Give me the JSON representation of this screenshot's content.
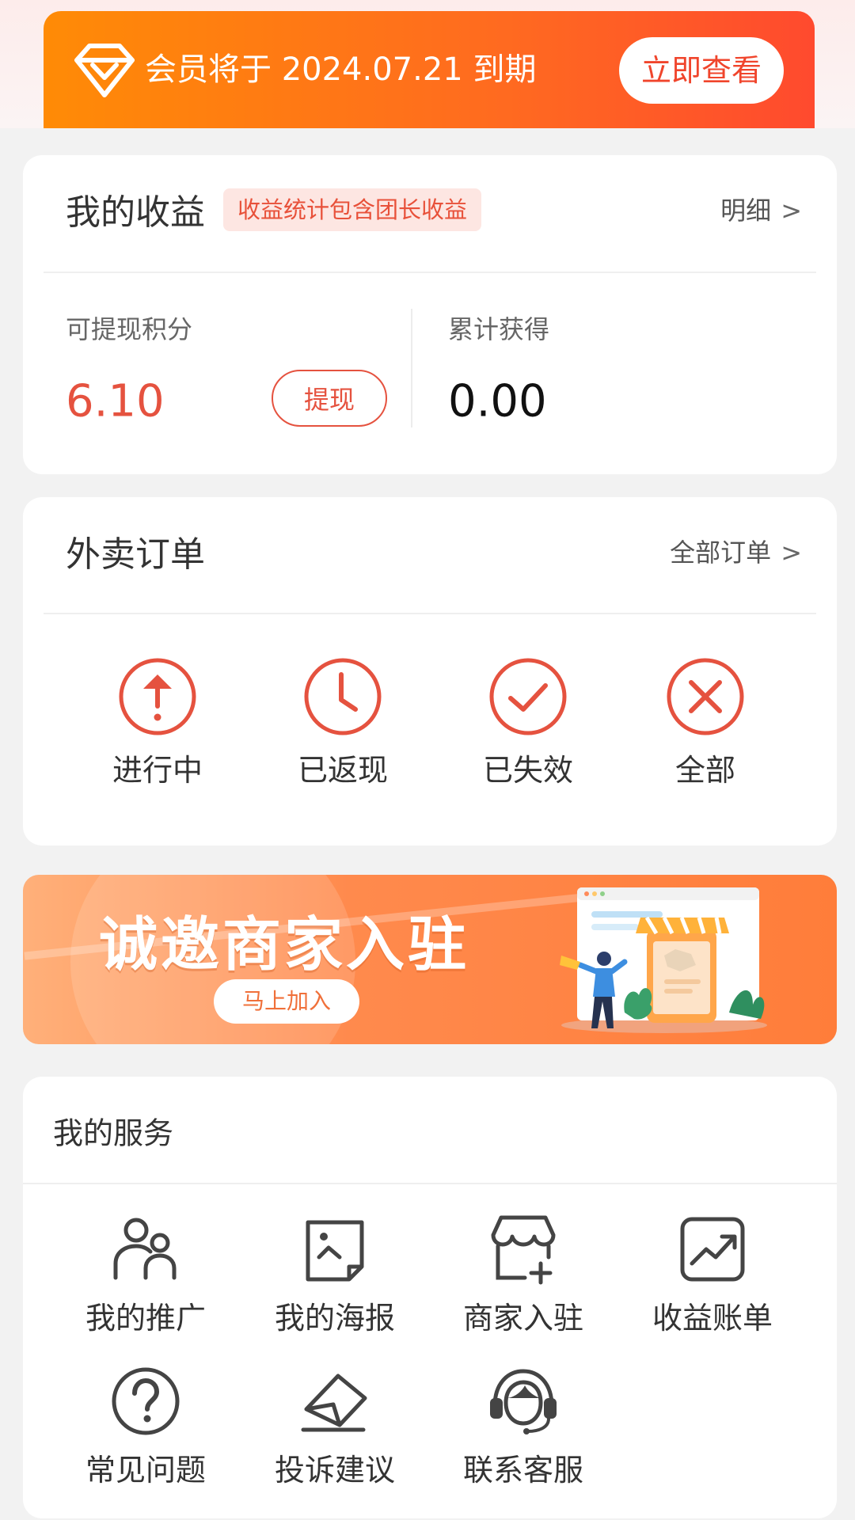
{
  "vip": {
    "text": "会员将于 2024.07.21 到期",
    "button": "立即查看"
  },
  "earnings": {
    "title": "我的收益",
    "tag": "收益统计包含团长收益",
    "detail_link": "明细",
    "withdrawable_label": "可提现积分",
    "withdrawable_value": "6.10",
    "withdraw_button": "提现",
    "total_label": "累计获得",
    "total_value": "0.00"
  },
  "orders": {
    "title": "外卖订单",
    "all_link": "全部订单",
    "items": [
      {
        "label": "进行中",
        "icon": "arrow-up-circle-icon"
      },
      {
        "label": "已返现",
        "icon": "clock-icon"
      },
      {
        "label": "已失效",
        "icon": "check-circle-icon"
      },
      {
        "label": "全部",
        "icon": "x-circle-icon"
      }
    ]
  },
  "promo": {
    "title": "诚邀商家入驻",
    "button": "马上加入"
  },
  "services": {
    "title": "我的服务",
    "items": [
      {
        "label": "我的推广",
        "icon": "users-icon"
      },
      {
        "label": "我的海报",
        "icon": "image-icon"
      },
      {
        "label": "商家入驻",
        "icon": "store-add-icon"
      },
      {
        "label": "收益账单",
        "icon": "trend-chart-icon"
      },
      {
        "label": "常见问题",
        "icon": "question-icon"
      },
      {
        "label": "投诉建议",
        "icon": "envelope-icon"
      },
      {
        "label": "联系客服",
        "icon": "headset-icon"
      }
    ]
  },
  "colors": {
    "accent": "#e5523f",
    "banner_start": "#ff8b06",
    "banner_end": "#ff4a2e",
    "page_bg": "#f2f2f2"
  }
}
